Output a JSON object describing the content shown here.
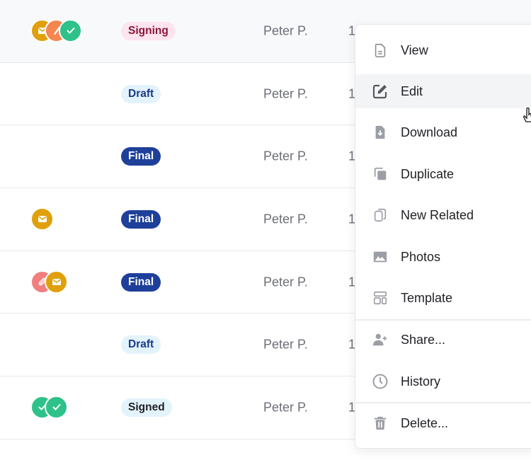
{
  "rows": [
    {
      "icons": [
        "mail-icon",
        "signature-icon",
        "check-icon"
      ],
      "icon_colors": [
        "#e0a00b",
        "#f5864f",
        "#2ec28a"
      ],
      "status": "Signing",
      "status_style": "signing",
      "author": "Peter P.",
      "date": "1"
    },
    {
      "icons": [],
      "icon_colors": [],
      "status": "Draft",
      "status_style": "draft",
      "author": "Peter P.",
      "date": "1"
    },
    {
      "icons": [],
      "icon_colors": [],
      "status": "Final",
      "status_style": "final",
      "author": "Peter P.",
      "date": "1"
    },
    {
      "icons": [
        "mail-icon"
      ],
      "icon_colors": [
        "#e0a00b"
      ],
      "status": "Final",
      "status_style": "final",
      "author": "Peter P.",
      "date": "1"
    },
    {
      "icons": [
        "attachment-icon",
        "mail-icon"
      ],
      "icon_colors": [
        "#f07f7f",
        "#e0a00b"
      ],
      "status": "Final",
      "status_style": "final",
      "author": "Peter P.",
      "date": "1"
    },
    {
      "icons": [],
      "icon_colors": [],
      "status": "Draft",
      "status_style": "draft",
      "author": "Peter P.",
      "date": "1"
    },
    {
      "icons": [
        "check-icon",
        "check-icon"
      ],
      "icon_colors": [
        "#2ec28a",
        "#2ec28a"
      ],
      "status": "Signed",
      "status_style": "signed",
      "author": "Peter P.",
      "date": "1"
    }
  ],
  "status_colors": {
    "signing": {
      "bg": "#fde4ee",
      "fg": "#8a1538"
    },
    "draft": {
      "bg": "#e3f3fb",
      "fg": "#1a3a8a"
    },
    "final": {
      "bg": "#1e3f9a",
      "fg": "#ffffff"
    },
    "signed": {
      "bg": "#e3f3fb",
      "fg": "#1f2024"
    }
  },
  "context_menu": {
    "items": [
      {
        "label": "View",
        "icon": "document-icon",
        "active": false
      },
      {
        "label": "Edit",
        "icon": "edit-icon",
        "active": true
      },
      {
        "label": "Download",
        "icon": "download-icon",
        "active": false
      },
      {
        "label": "Duplicate",
        "icon": "duplicate-icon",
        "active": false
      },
      {
        "label": "New Related",
        "icon": "copy-icon",
        "active": false
      },
      {
        "label": "Photos",
        "icon": "image-icon",
        "active": false
      },
      {
        "label": "Template",
        "icon": "template-icon",
        "active": false
      },
      {
        "label": "Share...",
        "icon": "user-plus-icon",
        "active": false
      },
      {
        "label": "History",
        "icon": "clock-icon",
        "active": false
      },
      {
        "label": "Delete...",
        "icon": "trash-icon",
        "active": false
      }
    ]
  }
}
